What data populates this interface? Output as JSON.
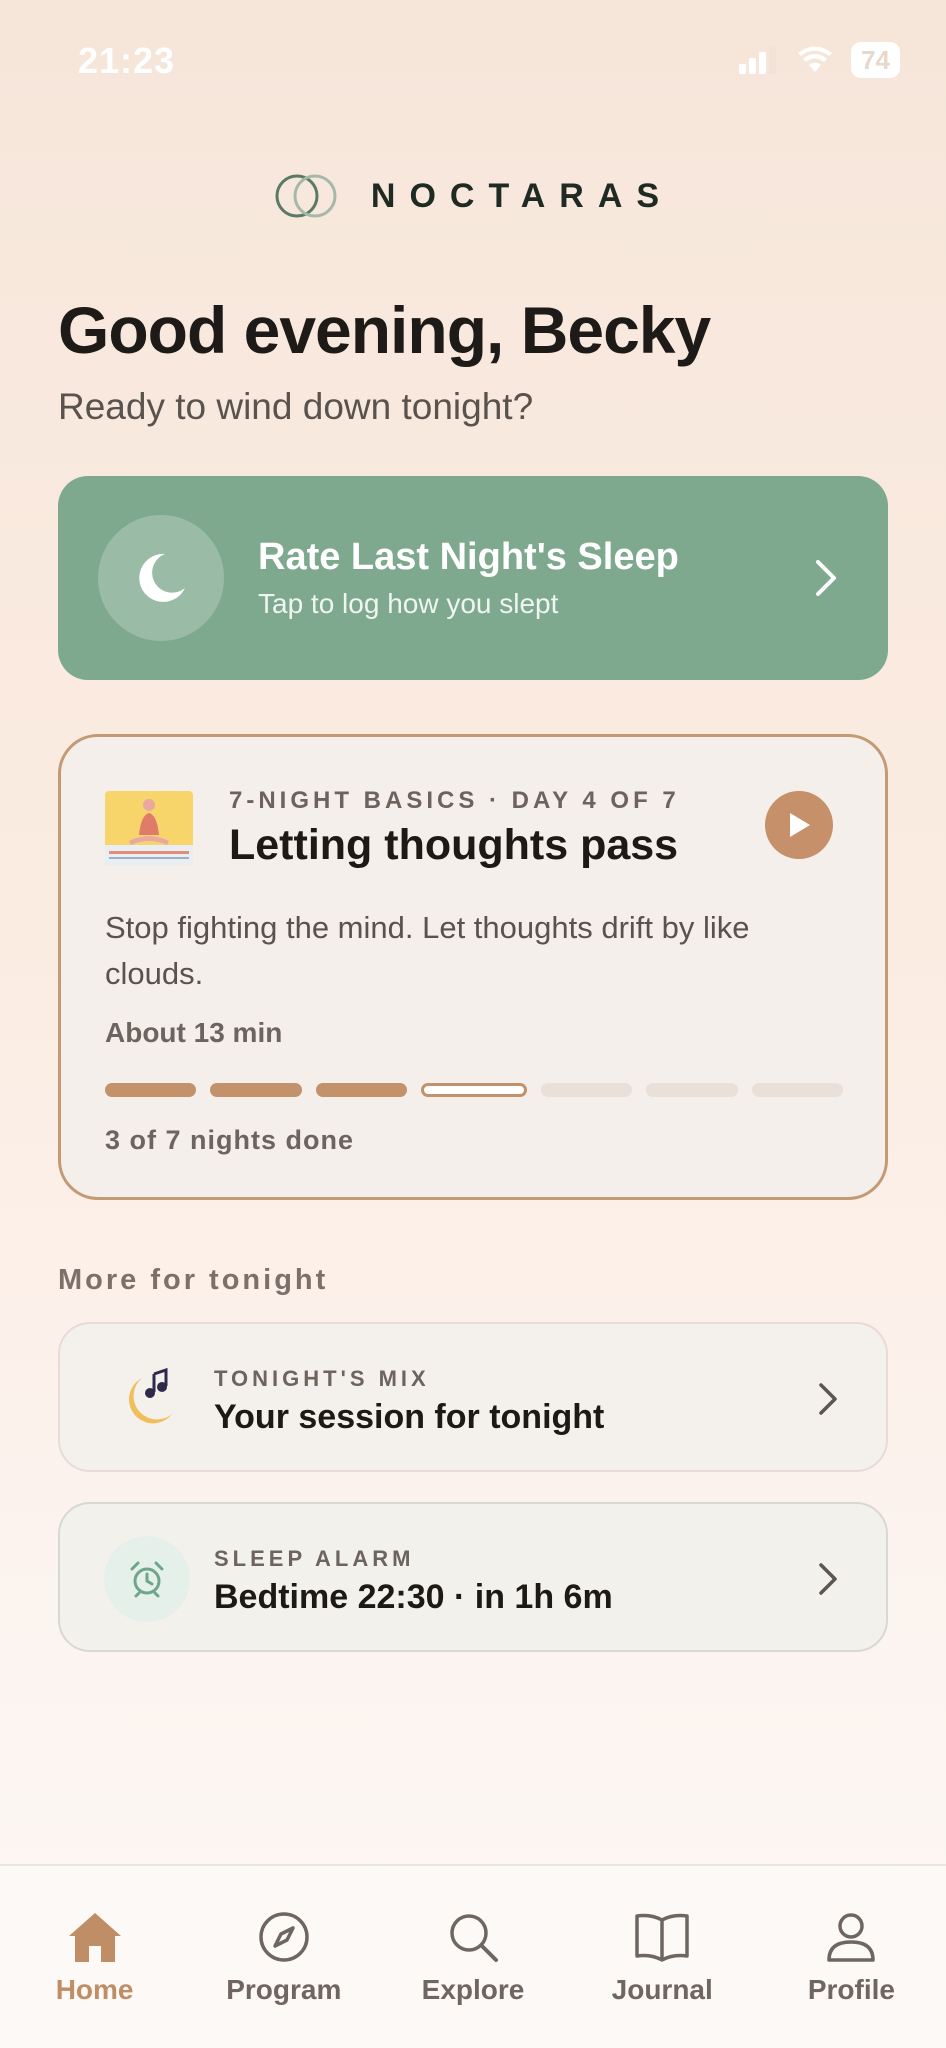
{
  "status_bar": {
    "time": "21:23",
    "battery": "74"
  },
  "brand": {
    "name": "NOCTARAS"
  },
  "greeting": {
    "title": "Good evening, Becky",
    "subtitle": "Ready to wind down tonight?"
  },
  "rate_card": {
    "title": "Rate Last Night's Sleep",
    "subtitle": "Tap to log how you slept",
    "color": "#7ea98f"
  },
  "program": {
    "kicker": "7-NIGHT BASICS · DAY 4 OF 7",
    "title": "Letting thoughts pass",
    "description": "Stop fighting the mind. Let thoughts drift by like clouds.",
    "duration": "About 13 min",
    "progress_done": 3,
    "progress_total": 7,
    "progress_label": "3 of 7 nights done",
    "accent": "#c3916a"
  },
  "more": {
    "section_title": "More for tonight",
    "items": [
      {
        "kicker": "TONIGHT'S MIX",
        "title": "Your session for tonight",
        "icon": "moon-music-icon"
      },
      {
        "kicker": "SLEEP ALARM",
        "title": "Bedtime 22:30 · in 1h 6m",
        "icon": "alarm-clock-icon"
      }
    ]
  },
  "tabs": [
    {
      "label": "Home",
      "icon": "home-icon",
      "active": true
    },
    {
      "label": "Program",
      "icon": "compass-icon",
      "active": false
    },
    {
      "label": "Explore",
      "icon": "search-icon",
      "active": false
    },
    {
      "label": "Journal",
      "icon": "book-icon",
      "active": false
    },
    {
      "label": "Profile",
      "icon": "person-icon",
      "active": false
    }
  ]
}
